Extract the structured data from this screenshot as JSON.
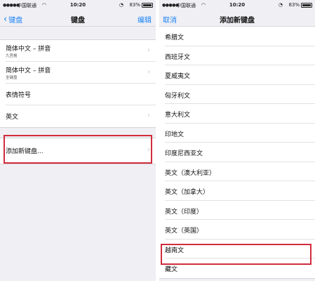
{
  "left": {
    "status": {
      "carrier": "中国联通",
      "time": "10:20",
      "battery": "83%",
      "battery_level": 0.83
    },
    "nav": {
      "back": "键盘",
      "title": "键盘",
      "action": "编辑"
    },
    "keyboards": [
      {
        "label": "简体中文 – 拼音",
        "sub": "九宫格"
      },
      {
        "label": "简体中文 – 拼音",
        "sub": "全键盘"
      },
      {
        "label": "表情符号",
        "sub": ""
      },
      {
        "label": "英文",
        "sub": ""
      }
    ],
    "add_keyboard": "添加新键盘..."
  },
  "right": {
    "status": {
      "carrier": "中国联通",
      "time": "10:20",
      "battery": "83%",
      "battery_level": 0.83
    },
    "nav": {
      "cancel": "取消",
      "title": "添加新键盘"
    },
    "languages": [
      "希腊文",
      "西班牙文",
      "夏威夷文",
      "匈牙利文",
      "意大利文",
      "印地文",
      "印度尼西亚文",
      "英文（澳大利亚）",
      "英文（加拿大）",
      "英文（印度）",
      "英文（英国）",
      "越南文",
      "藏文"
    ]
  }
}
